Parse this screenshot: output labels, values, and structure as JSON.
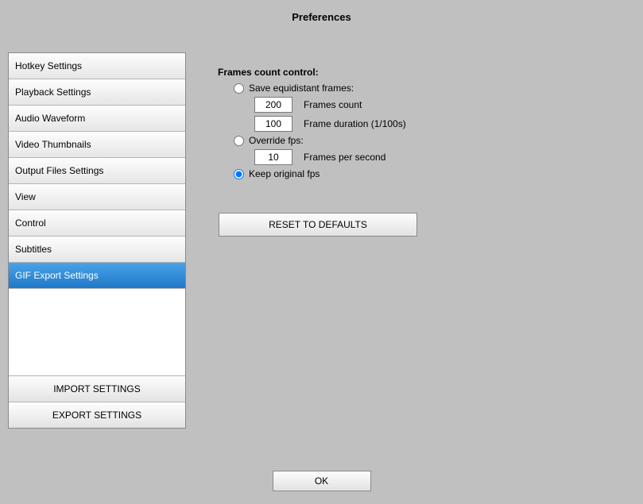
{
  "title": "Preferences",
  "sidebar": {
    "items": [
      {
        "label": "Hotkey Settings"
      },
      {
        "label": "Playback Settings"
      },
      {
        "label": "Audio Waveform"
      },
      {
        "label": "Video Thumbnails"
      },
      {
        "label": "Output Files Settings"
      },
      {
        "label": "View"
      },
      {
        "label": "Control"
      },
      {
        "label": "Subtitles"
      },
      {
        "label": "GIF Export Settings"
      }
    ],
    "selected_index": 8,
    "import_label": "IMPORT SETTINGS",
    "export_label": "EXPORT SETTINGS"
  },
  "content": {
    "section_title": "Frames count control:",
    "opt_equidistant": {
      "label": "Save equidistant frames:",
      "checked": false,
      "frames_count": {
        "value": "200",
        "label": "Frames count"
      },
      "frame_duration": {
        "value": "100",
        "label": "Frame duration (1/100s)"
      }
    },
    "opt_override": {
      "label": "Override fps:",
      "checked": false,
      "fps": {
        "value": "10",
        "label": "Frames per second"
      }
    },
    "opt_keep": {
      "label": "Keep original fps",
      "checked": true
    },
    "reset_label": "RESET TO DEFAULTS"
  },
  "ok_label": "OK"
}
